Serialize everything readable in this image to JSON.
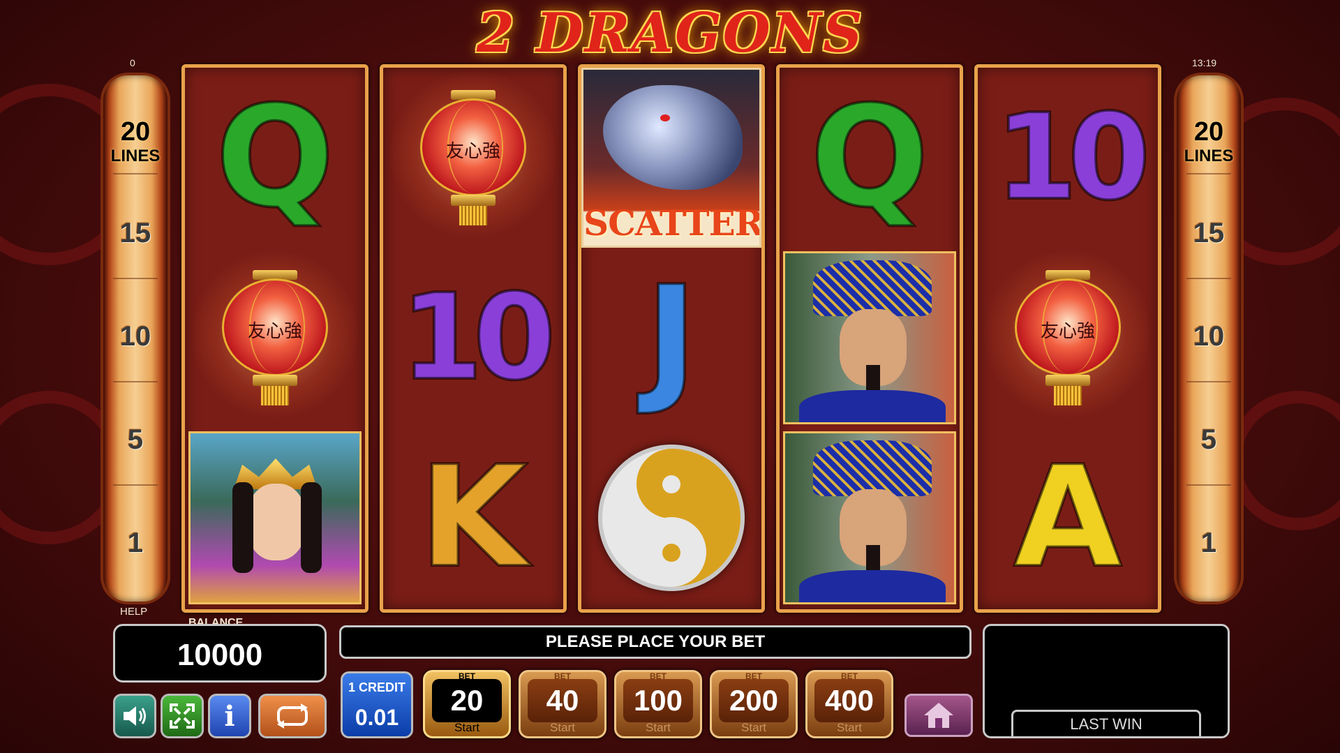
{
  "game": {
    "title": "2 DRAGONS"
  },
  "counters": {
    "left_top": "0",
    "clock": "13:19",
    "help_label": "HELP"
  },
  "lines": {
    "top_value": "20",
    "top_label": "LINES",
    "markers": [
      "15",
      "10",
      "5",
      "1"
    ]
  },
  "reels": [
    {
      "symbols": [
        "Q",
        "lantern",
        "empress"
      ]
    },
    {
      "symbols": [
        "lantern",
        "10",
        "K"
      ]
    },
    {
      "symbols": [
        "scatter",
        "J",
        "yin-yang"
      ]
    },
    {
      "symbols": [
        "Q",
        "emperor",
        "emperor"
      ]
    },
    {
      "symbols": [
        "10",
        "lantern",
        "A"
      ]
    }
  ],
  "symbols": {
    "Q": "Q",
    "J": "J",
    "K": "K",
    "A": "A",
    "ten": "10",
    "scatter_text": "SCATTER",
    "lantern_glyph": "友心強"
  },
  "colors": {
    "Q": "#2aa82a",
    "ten": "#8a3fd8",
    "J": "#3a86e0",
    "K": "#e4a22a",
    "A": "#f0d020",
    "reel_border": "#e9a24b",
    "reel_bg": "#7a1d16"
  },
  "balance": {
    "label": "BALANCE",
    "value": "10000"
  },
  "message": "PLEASE PLACE YOUR BET",
  "credit": {
    "label": "1 CREDIT",
    "value": "0.01"
  },
  "bets": [
    {
      "cap": "BET",
      "value": "20",
      "start": "Start",
      "active": true
    },
    {
      "cap": "BET",
      "value": "40",
      "start": "Start",
      "active": false
    },
    {
      "cap": "BET",
      "value": "100",
      "start": "Start",
      "active": false
    },
    {
      "cap": "BET",
      "value": "200",
      "start": "Start",
      "active": false
    },
    {
      "cap": "BET",
      "value": "400",
      "start": "Start",
      "active": false
    }
  ],
  "last_win": {
    "label": "LAST WIN",
    "value": ""
  },
  "controls": {
    "info_label": "i",
    "sound_icon": "speaker-icon",
    "fullscreen_icon": "fullscreen-icon",
    "autoplay_icon": "autoplay-icon",
    "home_icon": "home-icon"
  }
}
